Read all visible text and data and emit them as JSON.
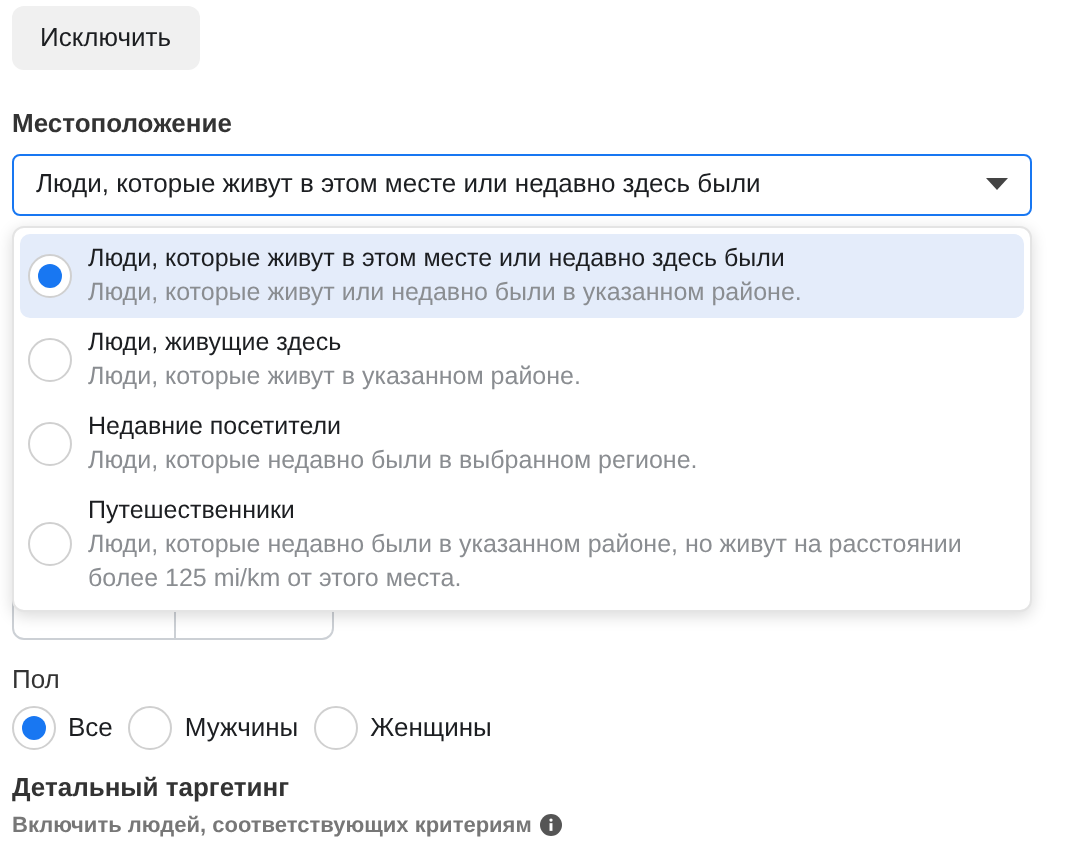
{
  "exclude_button": "Исключить",
  "location": {
    "label": "Местоположение",
    "value": "Люди, которые живут в этом месте или недавно здесь были",
    "expanded": true,
    "options": [
      {
        "title": "Люди, которые живут в этом месте или недавно здесь были",
        "description": "Люди, которые живут или недавно были в указанном районе.",
        "selected": true
      },
      {
        "title": "Люди, живущие здесь",
        "description": "Люди, которые живут в указанном районе.",
        "selected": false
      },
      {
        "title": "Недавние посетители",
        "description": "Люди, которые недавно были в выбранном регионе.",
        "selected": false
      },
      {
        "title": "Путешественники",
        "description": "Люди, которые недавно были в указанном районе, но живут на расстоянии более 125 mi/km от этого места.",
        "selected": false
      }
    ]
  },
  "gender": {
    "label": "Пол",
    "options": [
      {
        "label": "Все",
        "selected": true
      },
      {
        "label": "Мужчины",
        "selected": false
      },
      {
        "label": "Женщины",
        "selected": false
      }
    ]
  },
  "detailed_targeting": {
    "title": "Детальный таргетинг",
    "subtitle": "Включить людей, соответствующих критериям"
  }
}
